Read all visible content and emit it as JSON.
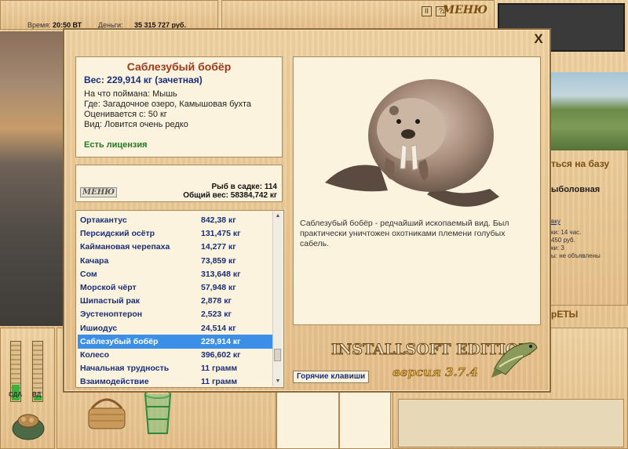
{
  "status_bar": {
    "time_label": "Время:",
    "time_value": "20:50 ВТ",
    "money_label": "Деньги:",
    "money_value": "35 315 727 руб."
  },
  "top_controls": {
    "pause": "II",
    "help": "?",
    "menu": "МЕНЮ"
  },
  "right_panel": {
    "header": "ться на базу",
    "subheader": "ыболовная",
    "link": "вку",
    "lines": [
      "ки: 14 час.",
      "450 руб.",
      "ки: 3",
      "ы: не объявлены"
    ],
    "bottom_header": "рЕТЫ"
  },
  "meters": {
    "left_label": "СДА",
    "right_label": "ВД"
  },
  "dialog": {
    "fish_name": "Саблезубый бобёр",
    "weight_line": "Вес: 229,914 кг (зачетная)",
    "bait_line": "На что поймана: Мышь",
    "location_line": "Где: Загадочное озеро, Камышовая бухта",
    "valued_line": "Оценивается с: 50 кг",
    "type_line": "Вид: Ловится очень редко",
    "license": "Есть лицензия",
    "mini_menu": "МЕНЮ",
    "fish_count": "Рыб в садке: 114",
    "total_weight": "Общий вес: 58384,742 кг",
    "catch_list": [
      {
        "name": "Ортакантус",
        "weight": "842,38 кг"
      },
      {
        "name": "Персидский осётр",
        "weight": "131,475 кг"
      },
      {
        "name": "Каймановая черепаха",
        "weight": "14,277 кг"
      },
      {
        "name": "Качара",
        "weight": "73,859 кг"
      },
      {
        "name": "Сом",
        "weight": "313,648 кг"
      },
      {
        "name": "Морской чёрт",
        "weight": "57,948 кг"
      },
      {
        "name": "Шипастый рак",
        "weight": "2,878 кг"
      },
      {
        "name": "Эустеноптерон",
        "weight": "2,523 кг"
      },
      {
        "name": "Ишиодус",
        "weight": "24,514 кг"
      },
      {
        "name": "Саблезубый бобёр",
        "weight": "229,914 кг"
      },
      {
        "name": "Колесо",
        "weight": "396,602 кг"
      },
      {
        "name": "Начальная трудность",
        "weight": "11 грамм"
      },
      {
        "name": "Взаимодействие",
        "weight": "11 грамм"
      }
    ],
    "selected_index": 9,
    "description": "Саблезубый бобёр - редчайший ископаемый вид. Был практически уничтожен охотниками племени голубых сабель.",
    "brand": "INSTALLSOFT EDITION",
    "version": "версия 3.7.4",
    "hotkeys_button": "Горячие клавиши",
    "close": "X"
  },
  "colors": {
    "title_red": "#a0391c",
    "value_blue": "#1a2e7a",
    "license_green": "#1e7b1e",
    "selection_blue": "#3b8fe6"
  }
}
